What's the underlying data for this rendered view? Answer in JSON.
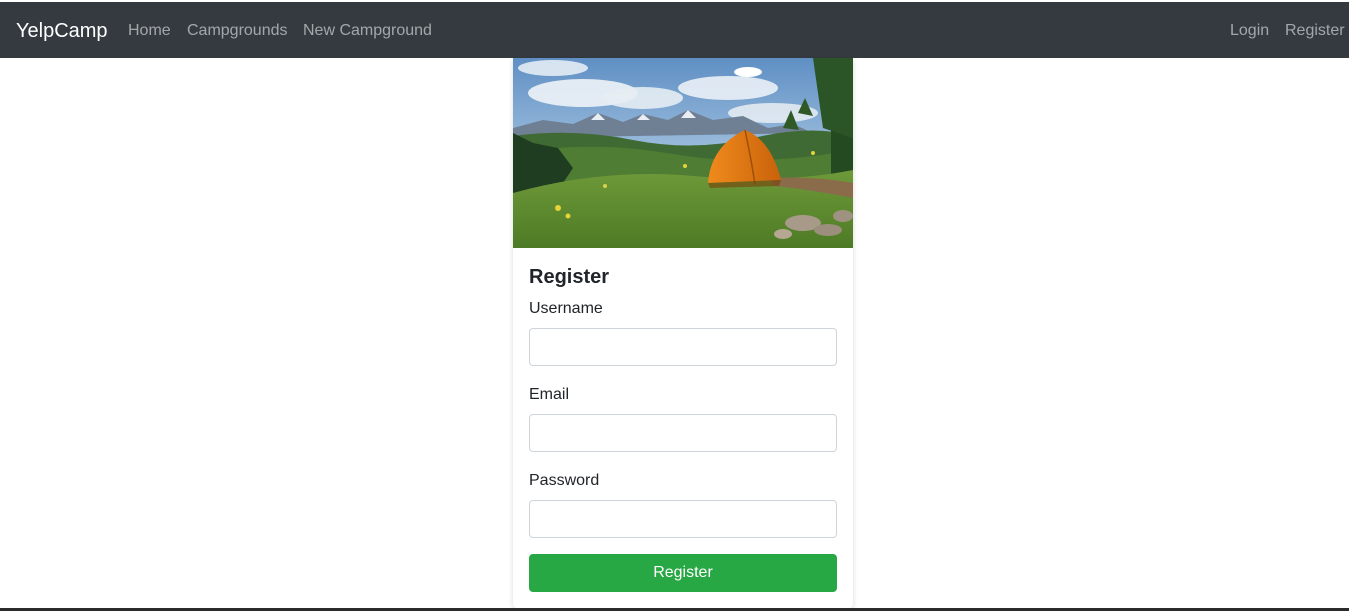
{
  "navbar": {
    "brand": "YelpCamp",
    "links": {
      "home": "Home",
      "campgrounds": "Campgrounds",
      "new_campground": "New Campground"
    },
    "auth": {
      "login": "Login",
      "register": "Register"
    },
    "background_color": "#343a40"
  },
  "card": {
    "image": "campsite-tent-photo",
    "title": "Register",
    "fields": {
      "username": {
        "label": "Username",
        "value": ""
      },
      "email": {
        "label": "Email",
        "value": ""
      },
      "password": {
        "label": "Password",
        "value": ""
      }
    },
    "submit_label": "Register",
    "submit_color": "#28a745"
  }
}
